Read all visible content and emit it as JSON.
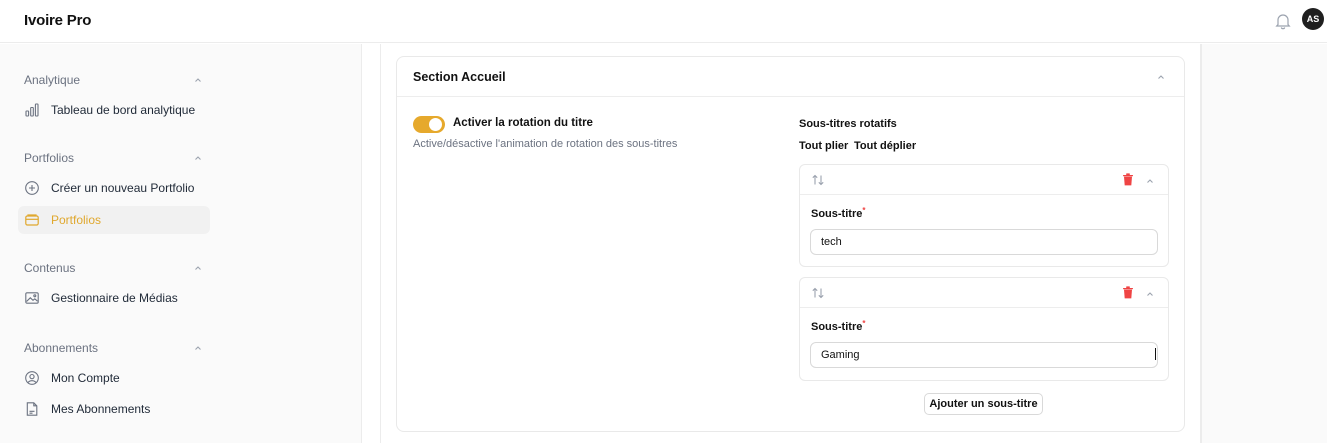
{
  "app": {
    "title": "Ivoire Pro"
  },
  "header": {
    "avatar_initials": "AS",
    "icons": [
      "bell-icon"
    ]
  },
  "sidebar": {
    "groups": [
      {
        "label": "Analytique",
        "items": [
          {
            "label": "Tableau de bord analytique",
            "icon": "bar-chart-icon"
          }
        ]
      },
      {
        "label": "Portfolios",
        "items": [
          {
            "label": "Créer un nouveau Portfolio",
            "icon": "plus-circle-icon"
          },
          {
            "label": "Portfolios",
            "icon": "folder-icon",
            "active": true
          }
        ]
      },
      {
        "label": "Contenus",
        "items": [
          {
            "label": "Gestionnaire de Médias",
            "icon": "image-icon"
          }
        ]
      },
      {
        "label": "Abonnements",
        "items": [
          {
            "label": "Mon Compte",
            "icon": "user-circle-icon"
          },
          {
            "label": "Mes Abonnements",
            "icon": "document-icon"
          }
        ]
      }
    ]
  },
  "section": {
    "title": "Section Accueil",
    "toggle": {
      "label": "Activer la rotation du titre",
      "description": "Active/désactive l'animation de rotation des sous-titres",
      "enabled": true
    },
    "subtitles": {
      "heading": "Sous-titres rotatifs",
      "fold_all": "Tout plier",
      "unfold_all": "Tout déplier",
      "items": [
        {
          "field_label": "Sous-titre",
          "required_mark": "*",
          "value": "tech"
        },
        {
          "field_label": "Sous-titre",
          "required_mark": "*",
          "value": "Gaming"
        }
      ],
      "add_label": "Ajouter un sous-titre"
    }
  },
  "colors": {
    "accent": "#e6a92c",
    "danger": "#ef4444",
    "active_text": "#e0a82e"
  }
}
